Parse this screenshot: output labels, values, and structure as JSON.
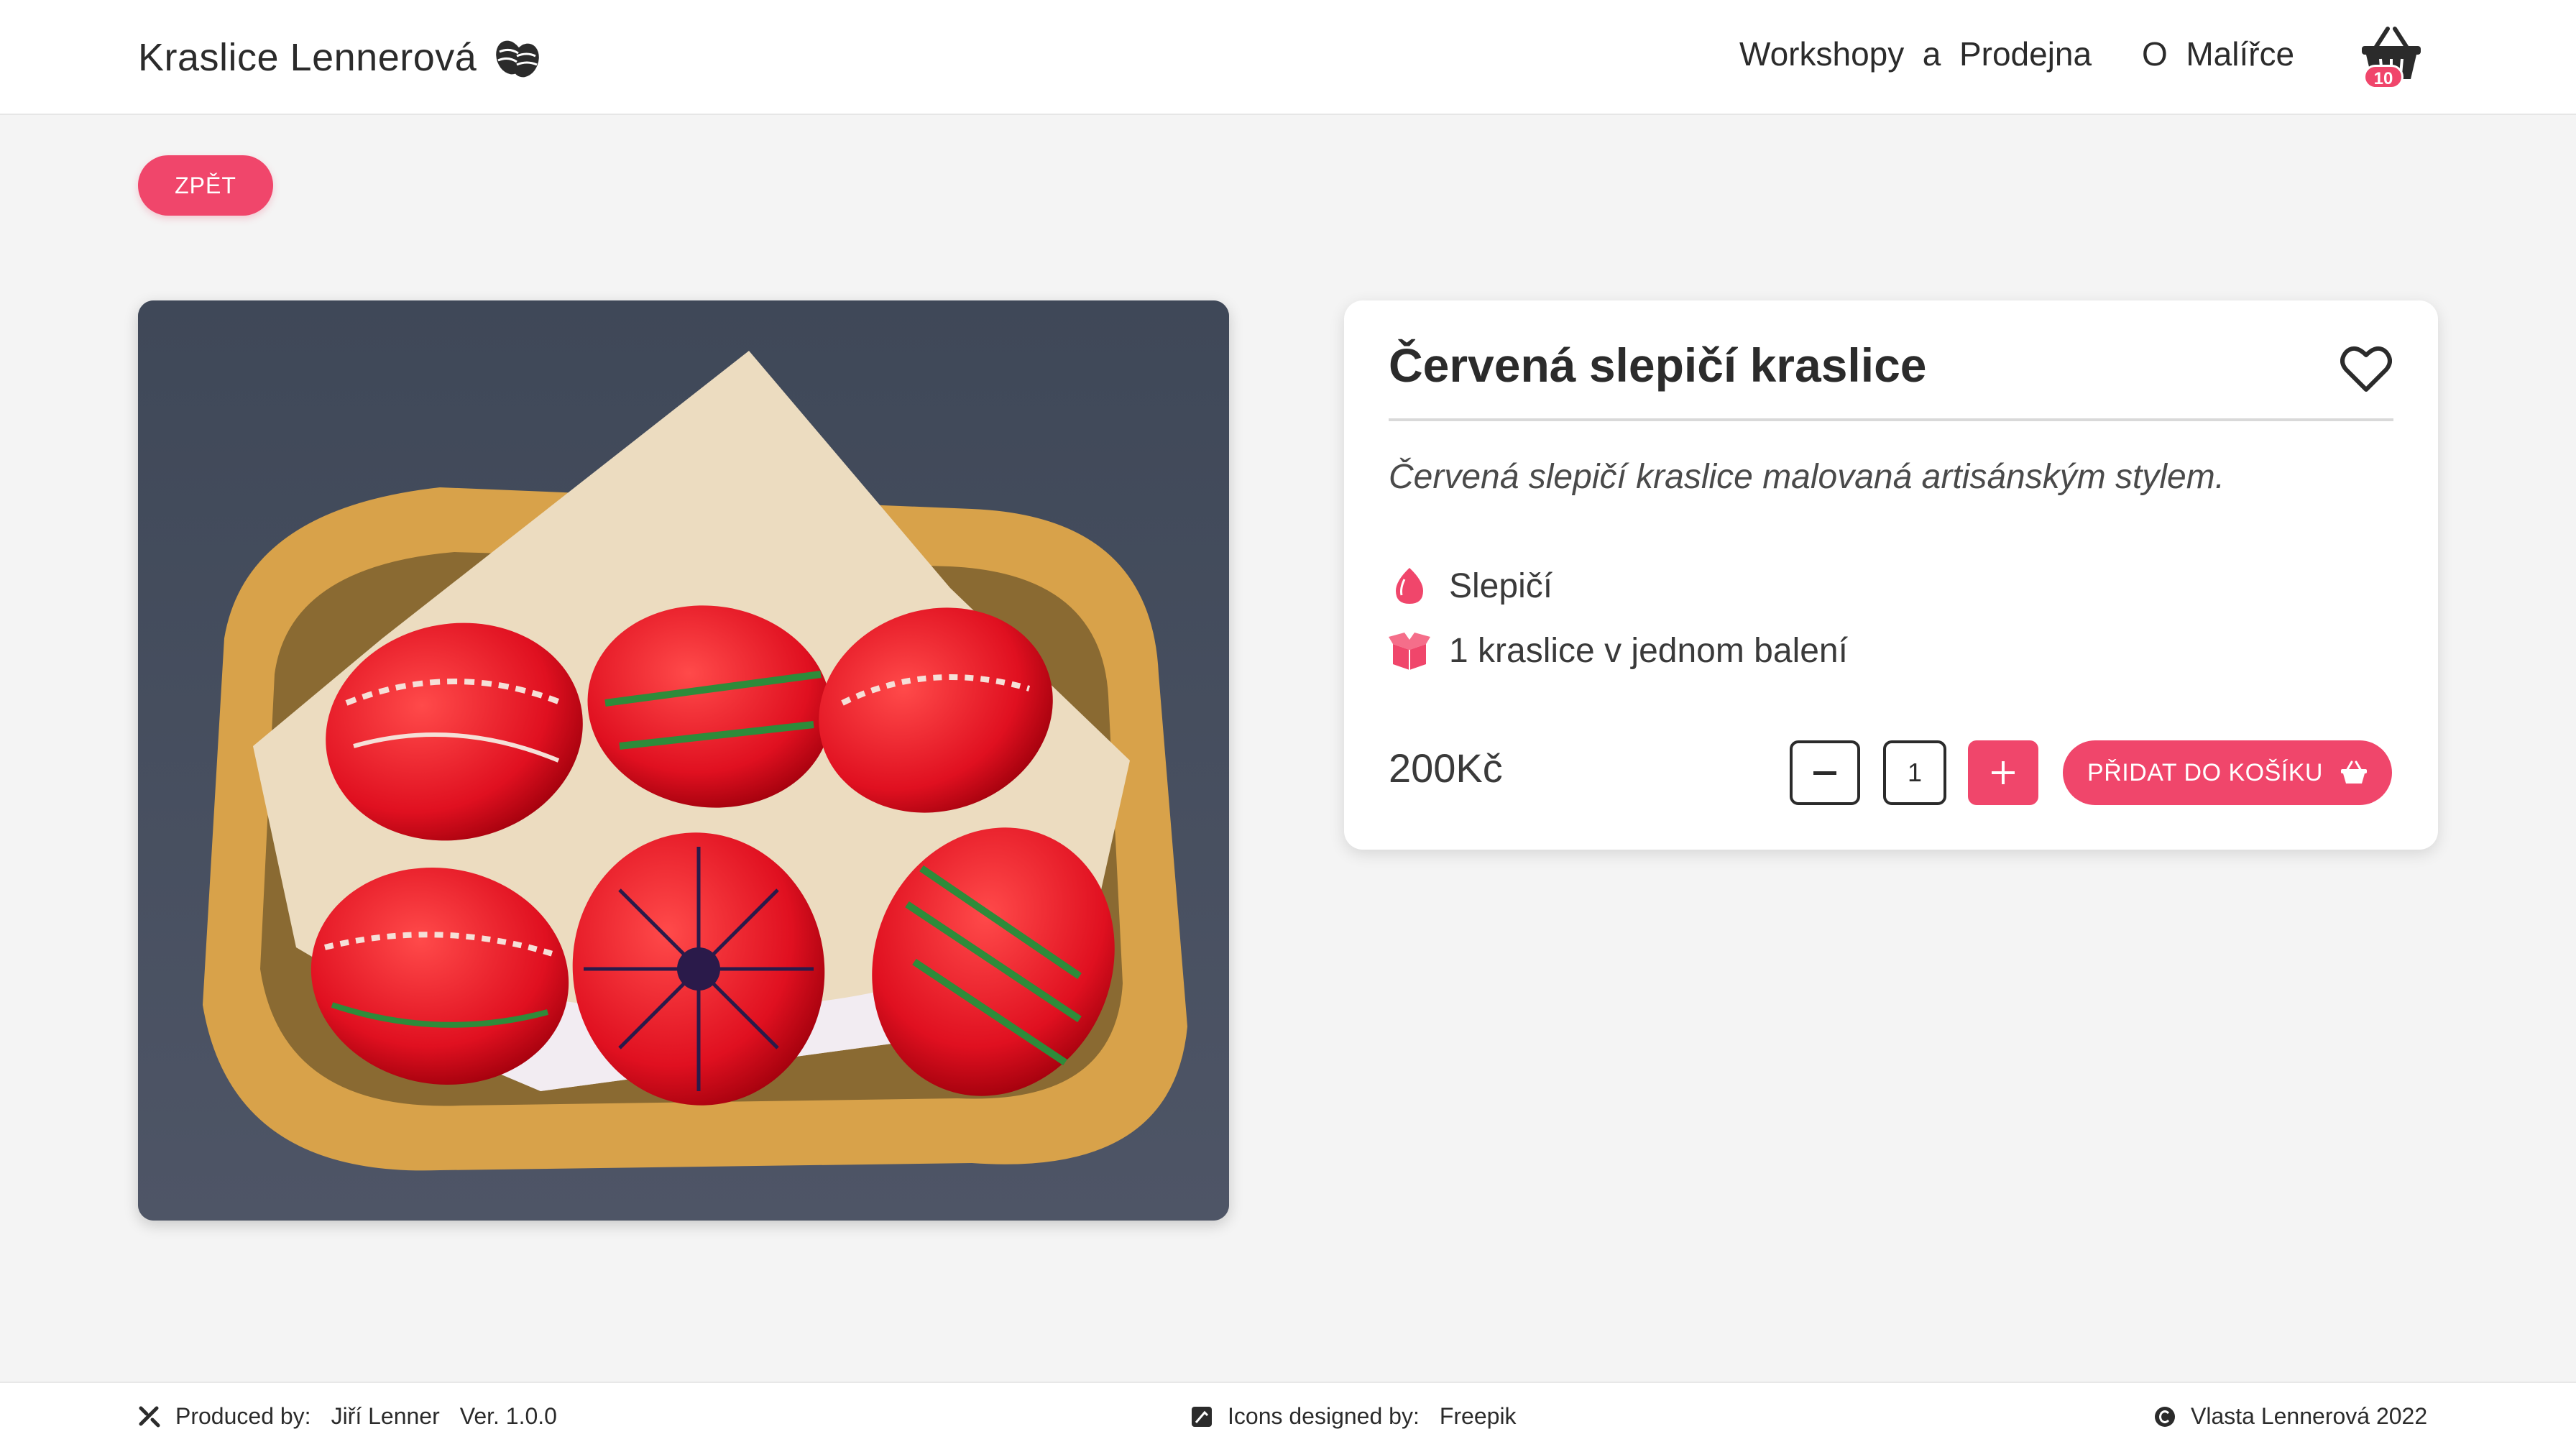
{
  "header": {
    "brand": "Kraslice  Lennerová",
    "brand_icon": "easter-eggs-icon",
    "nav": [
      {
        "label": "Workshopy  a  Prodejna"
      },
      {
        "label": "O  Malířce"
      }
    ],
    "cart": {
      "icon": "basket-icon",
      "count": "10"
    }
  },
  "back_button": {
    "label": "ZPĚT"
  },
  "product": {
    "image_alt": "red painted eggs in basket",
    "title": "Červená slepičí kraslice",
    "description": "Červená slepičí kraslice malovaná artisánským stylem.",
    "attributes": [
      {
        "icon": "egg-icon",
        "label": "Slepičí"
      },
      {
        "icon": "box-icon",
        "label": "1 kraslice v jednom balení"
      }
    ],
    "price": "200Kč",
    "quantity": "1",
    "add_to_cart_label": "PŘIDAT DO KOŠÍKU"
  },
  "footer": {
    "produced_label": "Produced by:",
    "produced_name": "Jiří Lenner",
    "version": "Ver. 1.0.0",
    "icons_label": "Icons designed by:",
    "icons_author": "Freepik",
    "copyright": "Vlasta Lennerová 2022"
  },
  "colors": {
    "accent": "#f0466b",
    "background": "#f4f4f4",
    "text": "#2b2b2b"
  }
}
